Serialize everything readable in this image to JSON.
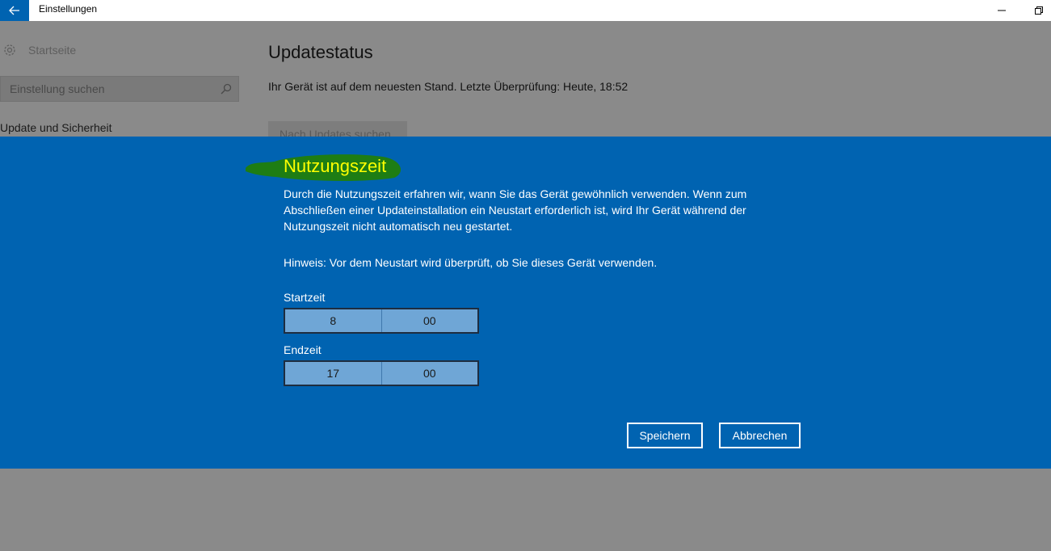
{
  "window": {
    "title": "Einstellungen",
    "back_icon": "arrow-left-icon",
    "minimize_icon": "minimize-icon",
    "maximize_icon": "restore-icon",
    "accent_color": "#0063b1"
  },
  "sidebar": {
    "home_label": "Startseite",
    "home_icon": "gear-icon",
    "search_placeholder": "Einstellung suchen",
    "search_icon": "search-icon",
    "section_title": "Update und Sicherheit"
  },
  "main": {
    "heading": "Updatestatus",
    "status": "Ihr Gerät ist auf dem neuesten Stand. Letzte Überprüfung: Heute, 18:52",
    "check_button": "Nach Updates suchen"
  },
  "dialog": {
    "title": "Nutzungszeit",
    "description": "Durch die Nutzungszeit erfahren wir, wann Sie das Gerät gewöhnlich verwenden. Wenn zum Abschließen einer Updateinstallation ein Neustart erforderlich ist, wird Ihr Gerät während der Nutzungszeit nicht automatisch neu gestartet.",
    "hint": "Hinweis: Vor dem Neustart wird überprüft, ob Sie dieses Gerät verwenden.",
    "start": {
      "label": "Startzeit",
      "hour": "8",
      "minute": "00"
    },
    "end": {
      "label": "Endzeit",
      "hour": "17",
      "minute": "00"
    },
    "save_button": "Speichern",
    "cancel_button": "Abbrechen",
    "background_color": "#0063b1",
    "title_color": "#ffff00",
    "title_highlight_color": "#1e7d14"
  }
}
